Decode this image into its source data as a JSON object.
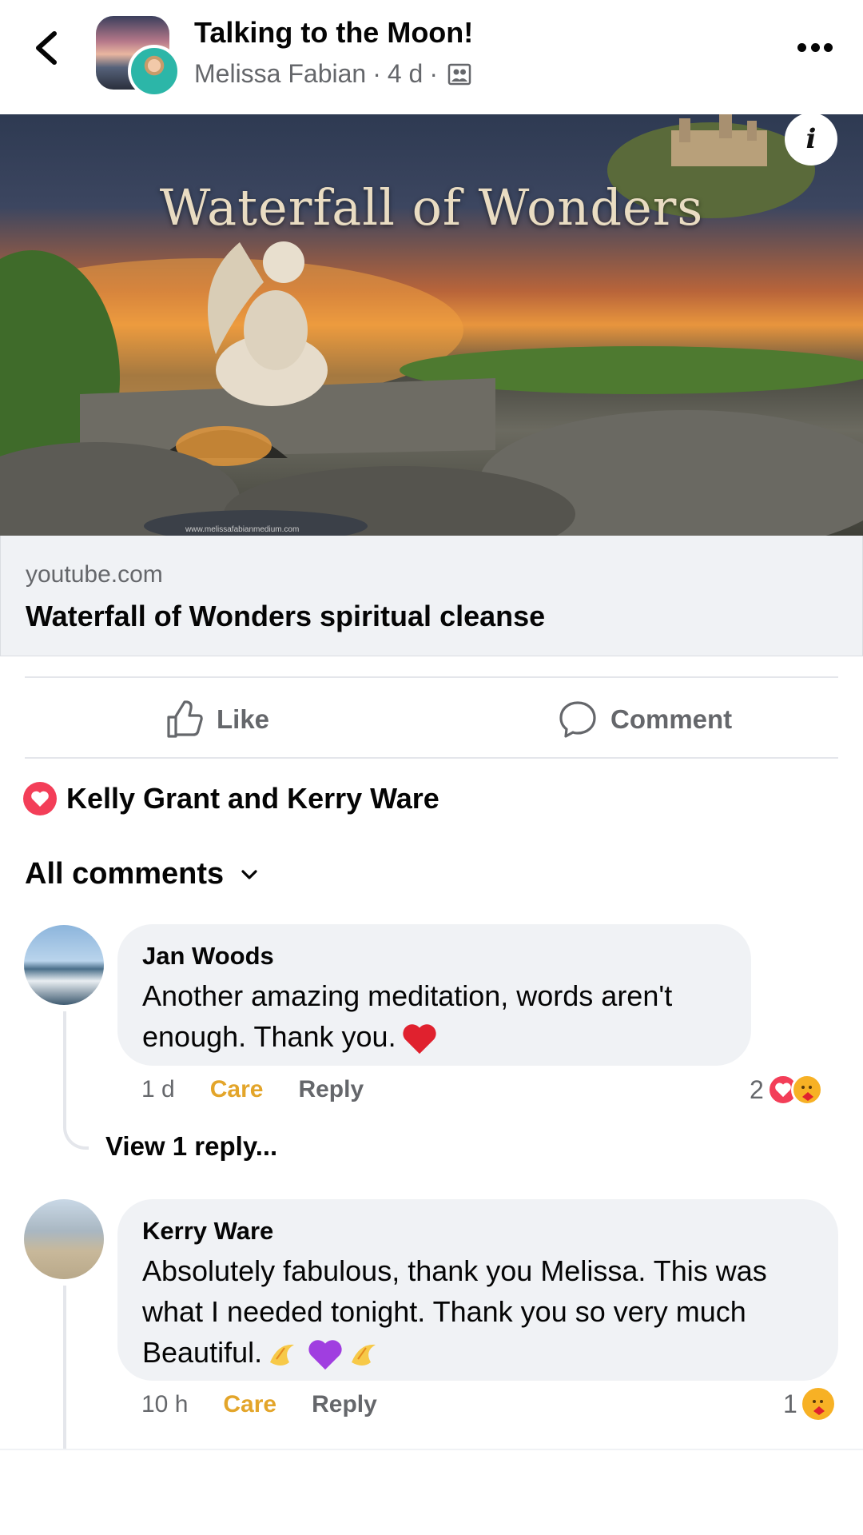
{
  "header": {
    "back_icon": "chevron-left-icon",
    "group_name": "Talking to the Moon!",
    "author": "Melissa Fabian",
    "separator": "·",
    "time": "4 d",
    "audience_icon": "group-icon",
    "more_icon": "more-horizontal-icon"
  },
  "link_preview": {
    "image_title": "Waterfall of Wonders",
    "watermark": "www.melissafabianmedium.com",
    "info_icon": "info-icon",
    "domain": "youtube.com",
    "title": "Waterfall of Wonders spiritual cleanse"
  },
  "actions": {
    "like_label": "Like",
    "comment_label": "Comment"
  },
  "reactions": {
    "icon": "love-reaction-icon",
    "names": "Kelly Grant and Kerry Ware"
  },
  "comments_header": {
    "label": "All comments"
  },
  "comments": [
    {
      "author": "Jan Woods",
      "text_line1": "Another amazing meditation,  words aren't",
      "text_line2": "enough.  Thank you.",
      "time": "1 d",
      "care_label": "Care",
      "reply_label": "Reply",
      "reaction_count": "2",
      "view_replies": "View 1 reply..."
    },
    {
      "author": "Kerry Ware",
      "text_line1": "Absolutely fabulous, thank you Melissa. This was",
      "text_line2": "what I needed tonight. Thank you so very much",
      "text_line3": "Beautiful.",
      "time": "10 h",
      "care_label": "Care",
      "reply_label": "Reply",
      "reaction_count": "1"
    }
  ],
  "colors": {
    "accent_care": "#e3a52a",
    "love": "#f33e58",
    "secondary_text": "#65676b",
    "bubble": "#f0f2f5"
  }
}
